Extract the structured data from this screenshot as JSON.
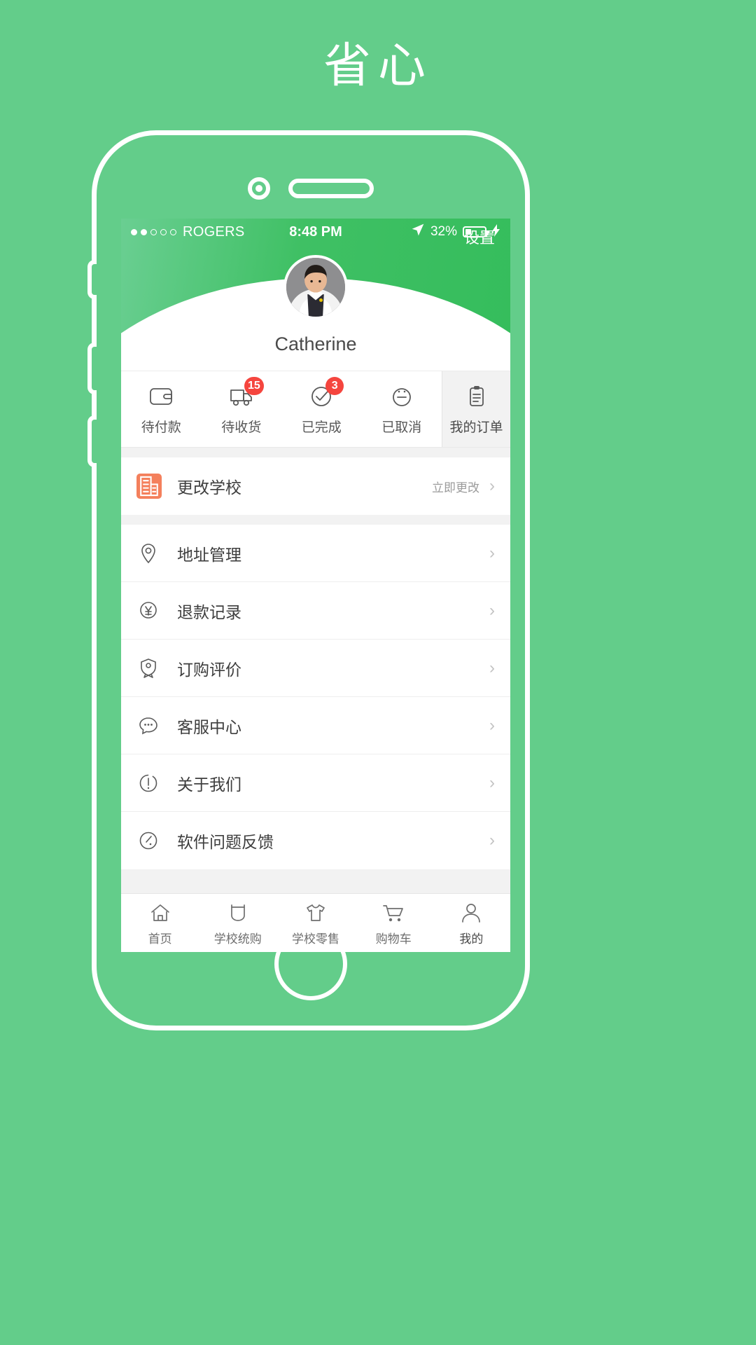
{
  "brand": {
    "title": "省心"
  },
  "status_bar": {
    "carrier": "ROGERS",
    "signal_dots_filled": 2,
    "signal_dots_total": 5,
    "time": "8:48 PM",
    "battery_percent": "32%",
    "location_icon": "location-arrow-icon",
    "charging_icon": "lightning-bolt-icon"
  },
  "header": {
    "settings_label": "设置",
    "username": "Catherine",
    "avatar_alt": "user-avatar"
  },
  "order_tabs": [
    {
      "label": "待付款",
      "icon": "wallet-icon",
      "badge": ""
    },
    {
      "label": "待收货",
      "icon": "delivery-truck-icon",
      "badge": "15"
    },
    {
      "label": "已完成",
      "icon": "check-circle-icon",
      "badge": "3"
    },
    {
      "label": "已取消",
      "icon": "neutral-face-icon",
      "badge": ""
    }
  ],
  "my_orders_tab": {
    "label": "我的订单",
    "icon": "clipboard-icon"
  },
  "menu_primary": [
    {
      "label": "更改学校",
      "icon": "school-building-icon",
      "action": "立即更改",
      "chevron": "›"
    }
  ],
  "menu_items": [
    {
      "label": "地址管理",
      "icon": "location-pin-icon",
      "chevron": "›"
    },
    {
      "label": "退款记录",
      "icon": "refund-yen-icon",
      "chevron": "›"
    },
    {
      "label": "订购评价",
      "icon": "review-badge-icon",
      "chevron": "›"
    },
    {
      "label": "客服中心",
      "icon": "chat-bubble-icon",
      "chevron": "›"
    },
    {
      "label": "关于我们",
      "icon": "info-circle-icon",
      "chevron": "›"
    },
    {
      "label": "软件问题反馈",
      "icon": "feedback-circle-icon",
      "chevron": "›"
    }
  ],
  "tabbar": [
    {
      "label": "首页",
      "icon": "home-icon",
      "active": false
    },
    {
      "label": "学校统购",
      "icon": "bag-icon",
      "active": false
    },
    {
      "label": "学校零售",
      "icon": "tshirt-icon",
      "active": false
    },
    {
      "label": "购物车",
      "icon": "cart-icon",
      "active": false
    },
    {
      "label": "我的",
      "icon": "person-icon",
      "active": true
    }
  ],
  "colors": {
    "background_green": "#63cd8a",
    "header_green": "#3fc064",
    "badge_red": "#f5453e",
    "school_icon_orange": "#f4805c",
    "text_dark": "#3e3e3e",
    "text_muted": "#9b9b9b"
  }
}
